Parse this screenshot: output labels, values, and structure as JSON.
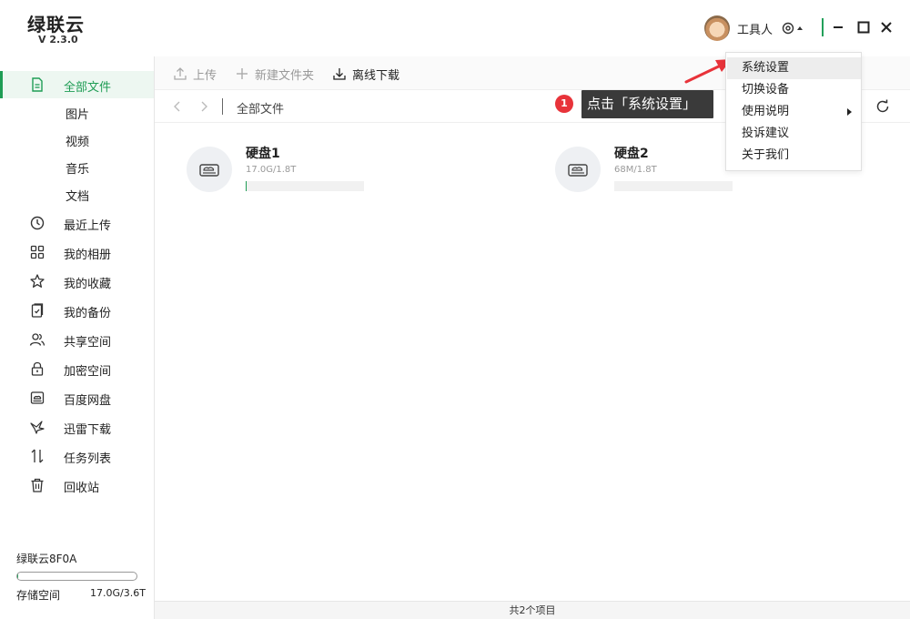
{
  "app": {
    "title": "绿联云",
    "version": "V 2.3.0"
  },
  "user": {
    "name": "工具人"
  },
  "sidebar": {
    "items": [
      {
        "label": "全部文件",
        "icon": "file-icon",
        "active": true
      },
      {
        "label": "图片",
        "sub": true
      },
      {
        "label": "视频",
        "sub": true
      },
      {
        "label": "音乐",
        "sub": true
      },
      {
        "label": "文档",
        "sub": true
      },
      {
        "label": "最近上传",
        "icon": "clock-icon"
      },
      {
        "label": "我的相册",
        "icon": "grid-icon"
      },
      {
        "label": "我的收藏",
        "icon": "star-icon"
      },
      {
        "label": "我的备份",
        "icon": "backup-icon"
      },
      {
        "label": "共享空间",
        "icon": "users-icon"
      },
      {
        "label": "加密空间",
        "icon": "lock-icon"
      },
      {
        "label": "百度网盘",
        "icon": "cloud-disk-icon"
      },
      {
        "label": "迅雷下载",
        "icon": "bird-icon"
      },
      {
        "label": "任务列表",
        "icon": "transfer-icon"
      },
      {
        "label": "回收站",
        "icon": "trash-icon"
      }
    ],
    "device_name": "绿联云8F0A",
    "storage_label": "存储空间",
    "storage_value": "17.0G/3.6T",
    "storage_fraction": 0.005
  },
  "toolbar": {
    "upload_label": "上传",
    "new_folder_label": "新建文件夹",
    "offline_download_label": "离线下载"
  },
  "path": {
    "current": "全部文件"
  },
  "disks": [
    {
      "name": "硬盘1",
      "size": "17.0G/1.8T",
      "used_fraction": 0.01
    },
    {
      "name": "硬盘2",
      "size": "68M/1.8T",
      "used_fraction": 0.0
    }
  ],
  "status": {
    "text": "共2个项目"
  },
  "menu": {
    "items": [
      {
        "label": "系统设置",
        "hover": true
      },
      {
        "label": "切换设备"
      },
      {
        "label": "使用说明",
        "submenu": true
      },
      {
        "label": "投诉建议"
      },
      {
        "label": "关于我们"
      }
    ]
  },
  "annotation": {
    "step": "1",
    "text": "点击「系统设置」"
  },
  "colors": {
    "accent": "#1f9d55",
    "badge": "#e8333a",
    "arrow": "#e8333a"
  }
}
